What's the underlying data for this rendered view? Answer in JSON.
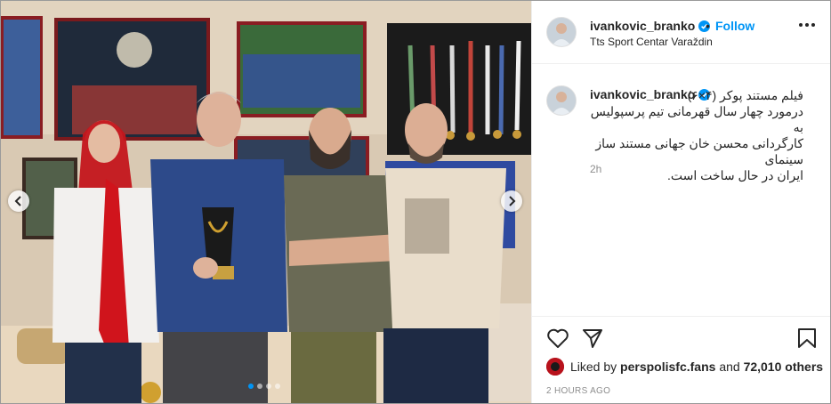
{
  "post": {
    "photo_alt": "",
    "carousel_dots": 4,
    "active_dot": 0
  },
  "header": {
    "username": "ivankovic_branko",
    "follow_label": "Follow",
    "separator": "•",
    "location": "Tts Sport Centar Varaždin"
  },
  "caption": {
    "username": "ivankovic_branko",
    "line1": "فیلم مستند پوکر (۴×۶)",
    "line2": "درمورد چهار سال قهرمانی تیم پرسپولیس به",
    "line3": "کارگردانی محسن خان جهانی مستند ساز سینمای",
    "line4": "ایران در حال ساخت است.",
    "time": "2h"
  },
  "likes": {
    "prefix": "Liked by",
    "user": "perspolisfc.fans",
    "middle": "and",
    "count": "72,010 others"
  },
  "timestamp": "2 HOURS AGO",
  "colors": {
    "accent": "#0095f6",
    "text": "#262626",
    "muted": "#8e8e8e",
    "border": "#efefef"
  },
  "icons": [
    "chevron-left-icon",
    "chevron-right-icon",
    "verified-badge-icon",
    "more-options-icon",
    "heart-icon",
    "share-icon",
    "bookmark-icon"
  ]
}
